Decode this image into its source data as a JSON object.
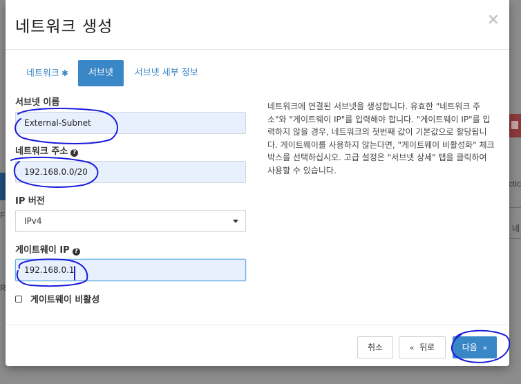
{
  "background": {
    "fragments": [
      "ctic",
      "네",
      "F",
      "R"
    ]
  },
  "modal": {
    "title": "네트워크 생성",
    "close_glyph": "×",
    "tabs": [
      {
        "label": "네트워크",
        "required": "✱"
      },
      {
        "label": "서브넷"
      },
      {
        "label": "서브넷 세부 정보"
      }
    ],
    "form": {
      "subnet_name": {
        "label": "서브넷 이름",
        "value": "External-Subnet"
      },
      "network_address": {
        "label": "네트워크 주소",
        "value": "192.168.0.0/20"
      },
      "ip_version": {
        "label": "IP 버전",
        "selected": "IPv4"
      },
      "gateway_ip": {
        "label": "게이트웨이 IP",
        "value": "192.168.0.1"
      },
      "disable_gateway": {
        "label": "게이트웨이 비활성"
      }
    },
    "help_text": "네트워크에 연결된 서브넷을 생성합니다. 유효한 \"네트워크 주소\"와 \"게이트웨이 IP\"를 입력해야 합니다. \"게이트웨이 IP\"를 입력하지 않을 경우, 네트워크의 첫번째 값이 기본값으로 할당됩니다. 게이트웨이를 사용하지 않는다면, \"게이트웨이 비활성화\" 체크박스를 선택하십시오. 고급 설정은 \"서브넷 상세\" 탭을 클릭하여 사용할 수 있습니다.",
    "footer": {
      "cancel": "취소",
      "back_arrow": "«",
      "back": "뒤로",
      "next": "다음",
      "next_arrow": "»"
    }
  },
  "colors": {
    "accent": "#3a87c8",
    "scribble": "#1a1adb",
    "input_fill": "#e8f0fe"
  }
}
